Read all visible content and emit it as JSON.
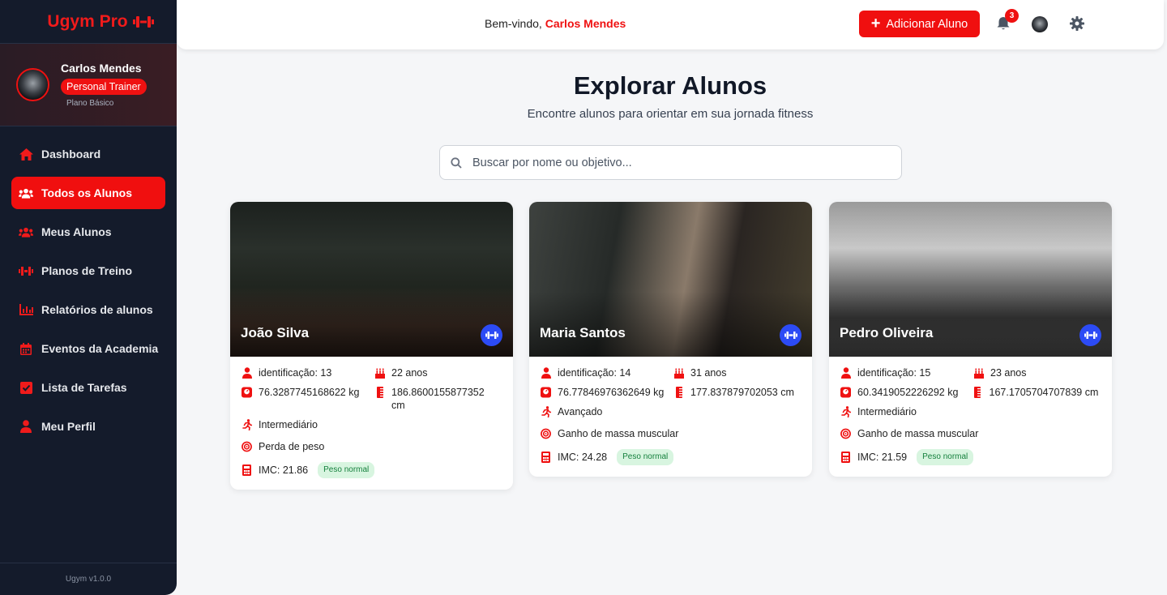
{
  "brand": {
    "name": "Ugym Pro"
  },
  "profile": {
    "name": "Carlos Mendes",
    "role": "Personal Trainer",
    "plan": "Plano Básico"
  },
  "nav": [
    {
      "label": "Dashboard",
      "icon": "home-icon",
      "active": false
    },
    {
      "label": "Todos os Alunos",
      "icon": "users-icon",
      "active": true
    },
    {
      "label": "Meus Alunos",
      "icon": "users-icon",
      "active": false
    },
    {
      "label": "Planos de Treino",
      "icon": "dumbbell-icon",
      "active": false
    },
    {
      "label": "Relatórios de alunos",
      "icon": "chart-icon",
      "active": false
    },
    {
      "label": "Eventos da Academia",
      "icon": "calendar-icon",
      "active": false
    },
    {
      "label": "Lista de Tarefas",
      "icon": "checkbox-icon",
      "active": false
    },
    {
      "label": "Meu Perfil",
      "icon": "user-icon",
      "active": false
    }
  ],
  "footer": {
    "version": "Ugym v1.0.0"
  },
  "header": {
    "welcome_prefix": "Bem-vindo,",
    "welcome_name": "Carlos Mendes",
    "add_button": "Adicionar Aluno",
    "notifications": "3"
  },
  "main": {
    "title": "Explorar Alunos",
    "subtitle": "Encontre alunos para orientar em sua jornada fitness",
    "search_placeholder": "Buscar por nome ou objetivo..."
  },
  "students": [
    {
      "name": "João Silva",
      "id": "identificação: 13",
      "age": "22 anos",
      "weight": "76.3287745168622 kg",
      "height": "186.8600155877352 cm",
      "level": "Intermediário",
      "goal": "Perda de peso",
      "imc": "IMC: 21.86",
      "status": "Peso normal"
    },
    {
      "name": "Maria Santos",
      "id": "identificação: 14",
      "age": "31 anos",
      "weight": "76.77846976362649 kg",
      "height": "177.837879702053 cm",
      "level": "Avançado",
      "goal": "Ganho de massa muscular",
      "imc": "IMC: 24.28",
      "status": "Peso normal"
    },
    {
      "name": "Pedro Oliveira",
      "id": "identificação: 15",
      "age": "23 anos",
      "weight": "60.3419052226292 kg",
      "height": "167.1705704707839 cm",
      "level": "Intermediário",
      "goal": "Ganho de massa muscular",
      "imc": "IMC: 21.59",
      "status": "Peso normal"
    }
  ],
  "colors": {
    "accent": "#f00f0f",
    "sidebar": "#141b2b",
    "badge_blue": "#2c4bf5",
    "status_green": "#15803d"
  }
}
